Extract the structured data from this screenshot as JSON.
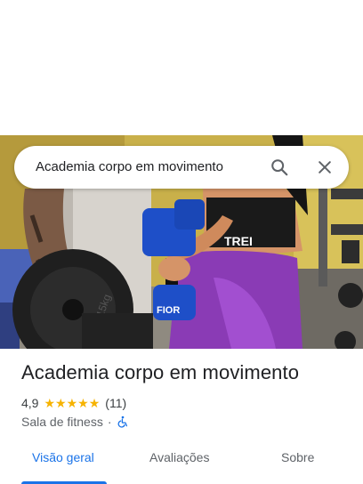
{
  "search": {
    "query": "Academia corpo em movimento",
    "search_icon": "search-icon",
    "close_icon": "close-icon"
  },
  "hero": {
    "photo_text_shirt": "TREI",
    "photo_text_dumbbell": "FIOR",
    "photo_text_plate": "15kg"
  },
  "place": {
    "name": "Academia corpo em movimento",
    "rating": "4,9",
    "stars": 5,
    "review_count": "(11)",
    "category": "Sala de fitness",
    "separator": "·",
    "accessibility_icon": "wheelchair-accessible-icon"
  },
  "tabs": [
    {
      "label": "Visão geral",
      "active": true
    },
    {
      "label": "Avaliações",
      "active": false
    },
    {
      "label": "Sobre",
      "active": false
    }
  ],
  "colors": {
    "accent": "#1a73e8",
    "star": "#f6b300",
    "text_primary": "#202124",
    "text_secondary": "#5f6368"
  }
}
